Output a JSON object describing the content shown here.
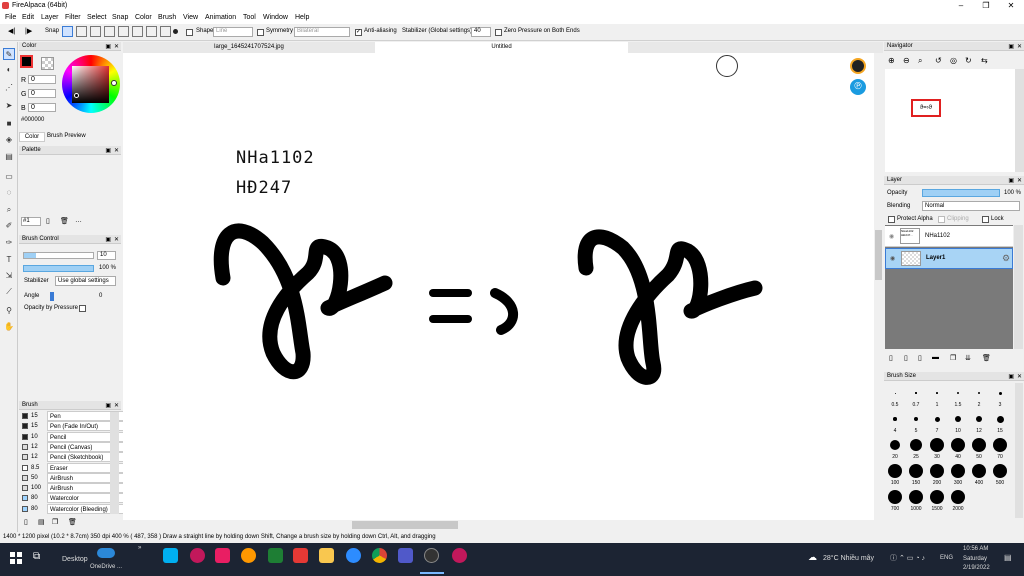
{
  "window": {
    "title": "FireAlpaca (64bit)"
  },
  "menu": [
    "File",
    "Edit",
    "Layer",
    "Filter",
    "Select",
    "Snap",
    "Color",
    "Brush",
    "View",
    "Animation",
    "Tool",
    "Window",
    "Help"
  ],
  "toolbar": {
    "snap": "Snap",
    "shape": "Shape",
    "shape_value": "Line",
    "symmetry": "Symmetry",
    "symmetry_value": "Bilateral",
    "antialias": "Anti-aliasing",
    "stabilizer": "Stabilizer (Global settings)",
    "stabilizer_value": "40",
    "zero_pressure": "Zero Pressure on Both Ends"
  },
  "tabs": [
    "large_1645241707524.jpg",
    "Untitled"
  ],
  "color_panel": {
    "title": "Color",
    "r_label": "R",
    "g_label": "G",
    "b_label": "B",
    "r": "0",
    "g": "0",
    "b": "0",
    "hex": "#000000",
    "tab_color": "Color",
    "tab_brush_preview": "Brush Preview"
  },
  "palette_panel": {
    "title": "Palette",
    "select": "#1"
  },
  "brush_control": {
    "title": "Brush Control",
    "size": "10",
    "opacity": "100 %",
    "stabilizer_label": "Stabilizer",
    "stabilizer_value": "Use global settings",
    "angle_label": "Angle",
    "angle_value": "0",
    "opacity_pressure": "Opacity by Pressure"
  },
  "brush_panel": {
    "title": "Brush",
    "items": [
      {
        "size": "15",
        "name": "Pen",
        "color": "#222222"
      },
      {
        "size": "15",
        "name": "Pen (Fade In/Out)",
        "color": "#222222"
      },
      {
        "size": "10",
        "name": "Pencil",
        "color": "#222222"
      },
      {
        "size": "12",
        "name": "Pencil (Canvas)",
        "color": "#dddddd"
      },
      {
        "size": "12",
        "name": "Pencil (Sketchbook)",
        "color": "#dddddd"
      },
      {
        "size": "8.5",
        "name": "Eraser",
        "color": "#ffffff"
      },
      {
        "size": "50",
        "name": "AirBrush",
        "color": "#dddddd"
      },
      {
        "size": "100",
        "name": "AirBrush",
        "color": "#dddddd"
      },
      {
        "size": "80",
        "name": "Watercolor",
        "color": "#9fd4ff"
      },
      {
        "size": "80",
        "name": "Watercolor (Bleeding)",
        "color": "#9fd4ff"
      }
    ]
  },
  "canvas": {
    "text_line1": "NHa1102",
    "text_line2": "HĐ247",
    "formula_mid": "=›"
  },
  "navigator": {
    "title": "Navigator"
  },
  "layer_panel": {
    "title": "Layer",
    "opacity_label": "Opacity",
    "opacity_value": "100 %",
    "blending_label": "Blending",
    "blending_value": "Normal",
    "protect_alpha": "Protect Alpha",
    "clipping": "Clipping",
    "lock": "Lock",
    "layers": [
      {
        "name": "NHa1102",
        "thumb": "NHa1102 HĐ247..."
      },
      {
        "name": "Layer1",
        "thumb": ""
      }
    ]
  },
  "brush_size_panel": {
    "title": "Brush Size",
    "sizes": [
      "0.5",
      "0.7",
      "1",
      "1.5",
      "2",
      "3",
      "4",
      "5",
      "7",
      "10",
      "12",
      "15",
      "20",
      "25",
      "30",
      "40",
      "50",
      "70",
      "100",
      "150",
      "200",
      "300",
      "400",
      "500",
      "700",
      "1000",
      "1500",
      "2000"
    ]
  },
  "status": {
    "text": "1400 * 1200 pixel  (10.2 * 8.7cm)  350 dpi  400 %  ( 487, 358 )  Draw a straight line by holding down Shift, Change a brush size by holding down Ctrl, Alt, and dragging"
  },
  "taskbar": {
    "desktop": "Desktop",
    "onedrive": "OneDrive ...",
    "weather": "28°C  Nhiều mây",
    "lang": "ENG",
    "time": "10:56 AM",
    "day": "Saturday",
    "date": "2/19/2022"
  }
}
